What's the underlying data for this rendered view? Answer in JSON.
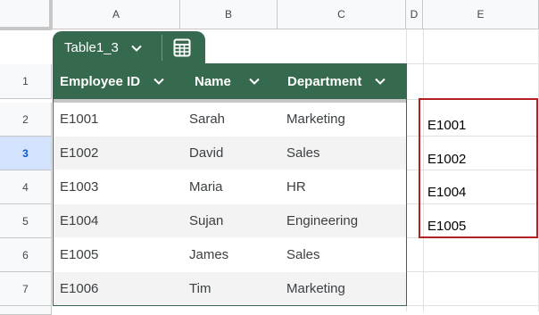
{
  "columns": [
    "A",
    "B",
    "C",
    "D",
    "E"
  ],
  "rows": [
    "1",
    "2",
    "3",
    "4",
    "5",
    "6",
    "7"
  ],
  "selected_row": "3",
  "table": {
    "name": "Table1_3",
    "headers": [
      "Employee ID",
      "Name",
      "Department"
    ],
    "data": [
      [
        "E1001",
        "Sarah",
        "Marketing"
      ],
      [
        "E1002",
        "David",
        "Sales"
      ],
      [
        "E1003",
        "Maria",
        "HR"
      ],
      [
        "E1004",
        "Sujan",
        "Engineering"
      ],
      [
        "E1005",
        "James",
        "Sales"
      ],
      [
        "E1006",
        "Tim",
        "Marketing"
      ]
    ]
  },
  "column_e": [
    "E1001",
    "E1002",
    "E1004",
    "E1005"
  ],
  "icons": {
    "tab_dropdown": "chevron-down-icon",
    "table_toggle": "table-calculator-icon",
    "header_dropdown": "chevron-down-icon"
  },
  "colors": {
    "table_header": "#356a4e",
    "highlight_box": "#b41f24",
    "row_stripe": "#f3f3f3"
  }
}
